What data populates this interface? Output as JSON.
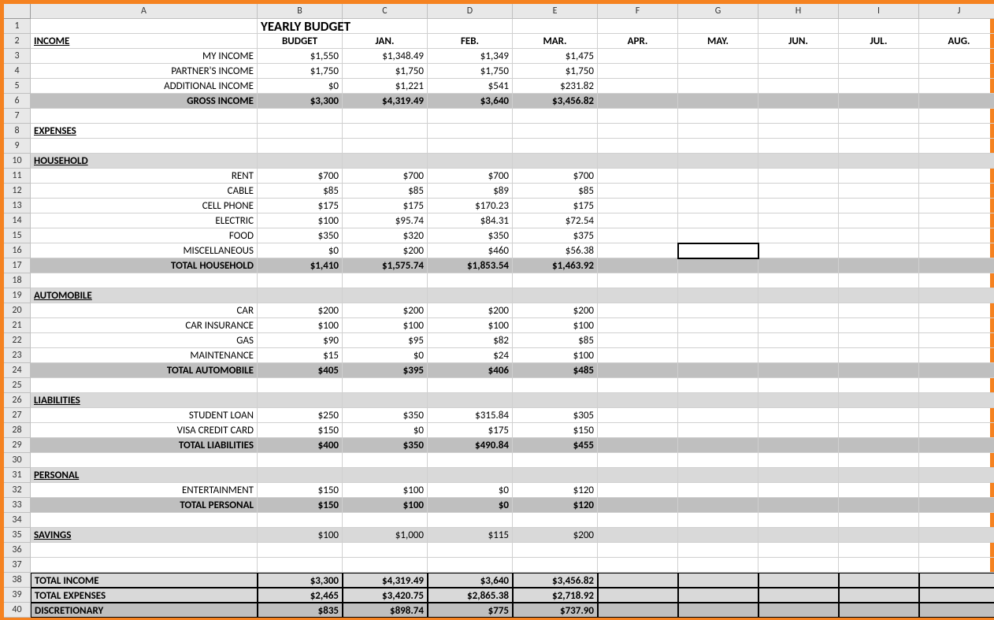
{
  "columns": [
    "A",
    "B",
    "C",
    "D",
    "E",
    "F",
    "G",
    "H",
    "I",
    "J"
  ],
  "rowCount": 40,
  "activeCell": {
    "row": 16,
    "col": 7
  },
  "title": "YEARLY BUDGET",
  "headers": {
    "income": "INCOME",
    "budget": "BUDGET",
    "months": [
      "JAN.",
      "FEB.",
      "MAR.",
      "APR.",
      "MAY.",
      "JUN.",
      "JUL.",
      "AUG."
    ]
  },
  "rows": {
    "3": {
      "label": "MY INCOME",
      "b": "$1,550",
      "c": "$1,348.49",
      "d": "$1,349",
      "e": "$1,475"
    },
    "4": {
      "label": "PARTNER'S INCOME",
      "b": "$1,750",
      "c": "$1,750",
      "d": "$1,750",
      "e": "$1,750"
    },
    "5": {
      "label": "ADDITIONAL INCOME",
      "b": "$0",
      "c": "$1,221",
      "d": "$541",
      "e": "$231.82"
    },
    "6": {
      "label": "GROSS INCOME",
      "b": "$3,300",
      "c": "$4,319.49",
      "d": "$3,640",
      "e": "$3,456.82"
    },
    "8": {
      "label": "EXPENSES"
    },
    "10": {
      "label": "HOUSEHOLD"
    },
    "11": {
      "label": "RENT",
      "b": "$700",
      "c": "$700",
      "d": "$700",
      "e": "$700"
    },
    "12": {
      "label": "CABLE",
      "b": "$85",
      "c": "$85",
      "d": "$89",
      "e": "$85"
    },
    "13": {
      "label": "CELL PHONE",
      "b": "$175",
      "c": "$175",
      "d": "$170.23",
      "e": "$175"
    },
    "14": {
      "label": "ELECTRIC",
      "b": "$100",
      "c": "$95.74",
      "d": "$84.31",
      "e": "$72.54"
    },
    "15": {
      "label": "FOOD",
      "b": "$350",
      "c": "$320",
      "d": "$350",
      "e": "$375"
    },
    "16": {
      "label": "MISCELLANEOUS",
      "b": "$0",
      "c": "$200",
      "d": "$460",
      "e": "$56.38"
    },
    "17": {
      "label": "TOTAL HOUSEHOLD",
      "b": "$1,410",
      "c": "$1,575.74",
      "d": "$1,853.54",
      "e": "$1,463.92"
    },
    "19": {
      "label": "AUTOMOBILE"
    },
    "20": {
      "label": "CAR",
      "b": "$200",
      "c": "$200",
      "d": "$200",
      "e": "$200"
    },
    "21": {
      "label": "CAR INSURANCE",
      "b": "$100",
      "c": "$100",
      "d": "$100",
      "e": "$100"
    },
    "22": {
      "label": "GAS",
      "b": "$90",
      "c": "$95",
      "d": "$82",
      "e": "$85"
    },
    "23": {
      "label": "MAINTENANCE",
      "b": "$15",
      "c": "$0",
      "d": "$24",
      "e": "$100"
    },
    "24": {
      "label": "TOTAL AUTOMOBILE",
      "b": "$405",
      "c": "$395",
      "d": "$406",
      "e": "$485"
    },
    "26": {
      "label": "LIABILITIES"
    },
    "27": {
      "label": "STUDENT LOAN",
      "b": "$250",
      "c": "$350",
      "d": "$315.84",
      "e": "$305"
    },
    "28": {
      "label": "VISA CREDIT CARD",
      "b": "$150",
      "c": "$0",
      "d": "$175",
      "e": "$150"
    },
    "29": {
      "label": "TOTAL LIABILITIES",
      "b": "$400",
      "c": "$350",
      "d": "$490.84",
      "e": "$455"
    },
    "31": {
      "label": "PERSONAL"
    },
    "32": {
      "label": "ENTERTAINMENT",
      "b": "$150",
      "c": "$100",
      "d": "$0",
      "e": "$120"
    },
    "33": {
      "label": "TOTAL PERSONAL",
      "b": "$150",
      "c": "$100",
      "d": "$0",
      "e": "$120"
    },
    "35": {
      "label": "SAVINGS",
      "b": "$100",
      "c": "$1,000",
      "d": "$115",
      "e": "$200"
    },
    "38": {
      "label": "TOTAL INCOME",
      "b": "$3,300",
      "c": "$4,319.49",
      "d": "$3,640",
      "e": "$3,456.82"
    },
    "39": {
      "label": "TOTAL EXPENSES",
      "b": "$2,465",
      "c": "$3,420.75",
      "d": "$2,865.38",
      "e": "$2,718.92"
    },
    "40": {
      "label": "DISCRETIONARY",
      "b": "$835",
      "c": "$898.74",
      "d": "$775",
      "e": "$737.90"
    }
  },
  "chart_data": {
    "type": "table",
    "title": "YEARLY BUDGET",
    "categories": [
      "BUDGET",
      "JAN.",
      "FEB.",
      "MAR."
    ],
    "series": [
      {
        "name": "MY INCOME",
        "values": [
          1550,
          1348.49,
          1349,
          1475
        ]
      },
      {
        "name": "PARTNER'S INCOME",
        "values": [
          1750,
          1750,
          1750,
          1750
        ]
      },
      {
        "name": "ADDITIONAL INCOME",
        "values": [
          0,
          1221,
          541,
          231.82
        ]
      },
      {
        "name": "GROSS INCOME",
        "values": [
          3300,
          4319.49,
          3640,
          3456.82
        ]
      },
      {
        "name": "RENT",
        "values": [
          700,
          700,
          700,
          700
        ]
      },
      {
        "name": "CABLE",
        "values": [
          85,
          85,
          89,
          85
        ]
      },
      {
        "name": "CELL PHONE",
        "values": [
          175,
          175,
          170.23,
          175
        ]
      },
      {
        "name": "ELECTRIC",
        "values": [
          100,
          95.74,
          84.31,
          72.54
        ]
      },
      {
        "name": "FOOD",
        "values": [
          350,
          320,
          350,
          375
        ]
      },
      {
        "name": "MISCELLANEOUS",
        "values": [
          0,
          200,
          460,
          56.38
        ]
      },
      {
        "name": "TOTAL HOUSEHOLD",
        "values": [
          1410,
          1575.74,
          1853.54,
          1463.92
        ]
      },
      {
        "name": "CAR",
        "values": [
          200,
          200,
          200,
          200
        ]
      },
      {
        "name": "CAR INSURANCE",
        "values": [
          100,
          100,
          100,
          100
        ]
      },
      {
        "name": "GAS",
        "values": [
          90,
          95,
          82,
          85
        ]
      },
      {
        "name": "MAINTENANCE",
        "values": [
          15,
          0,
          24,
          100
        ]
      },
      {
        "name": "TOTAL AUTOMOBILE",
        "values": [
          405,
          395,
          406,
          485
        ]
      },
      {
        "name": "STUDENT LOAN",
        "values": [
          250,
          350,
          315.84,
          305
        ]
      },
      {
        "name": "VISA CREDIT CARD",
        "values": [
          150,
          0,
          175,
          150
        ]
      },
      {
        "name": "TOTAL LIABILITIES",
        "values": [
          400,
          350,
          490.84,
          455
        ]
      },
      {
        "name": "ENTERTAINMENT",
        "values": [
          150,
          100,
          0,
          120
        ]
      },
      {
        "name": "TOTAL PERSONAL",
        "values": [
          150,
          100,
          0,
          120
        ]
      },
      {
        "name": "SAVINGS",
        "values": [
          100,
          1000,
          115,
          200
        ]
      },
      {
        "name": "TOTAL INCOME",
        "values": [
          3300,
          4319.49,
          3640,
          3456.82
        ]
      },
      {
        "name": "TOTAL EXPENSES",
        "values": [
          2465,
          3420.75,
          2865.38,
          2718.92
        ]
      },
      {
        "name": "DISCRETIONARY",
        "values": [
          835,
          898.74,
          775,
          737.9
        ]
      }
    ]
  }
}
